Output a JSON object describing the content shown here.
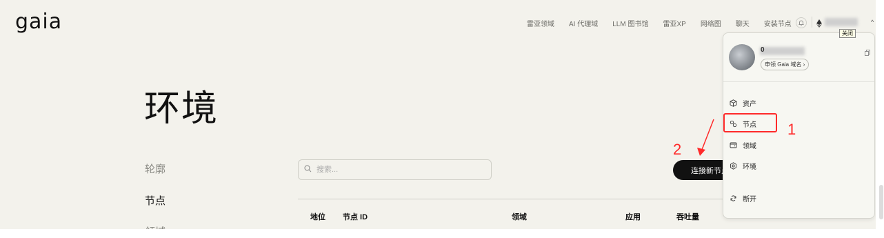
{
  "brand": {
    "logo": "gaia"
  },
  "nav": {
    "items": [
      "雷亚领域",
      "AI 代理域",
      "LLM 图书馆",
      "雷亚XP",
      "网络图",
      "聊天",
      "安装节点"
    ]
  },
  "header": {
    "wallet_tooltip": "关闭"
  },
  "page": {
    "title": "环境",
    "sidebar": [
      "轮廓",
      "节点",
      "领域"
    ],
    "search_placeholder": "搜索...",
    "connect_button": "连接新节点",
    "table_headers": [
      "地位",
      "节点 ID",
      "领域",
      "应用",
      "吞吐量"
    ]
  },
  "dropdown": {
    "user_initial": "0",
    "domain_link": "申领 Gaia 域名 ›",
    "items": [
      {
        "label": "资产",
        "icon": "cube-icon"
      },
      {
        "label": "节点",
        "icon": "node-icon"
      },
      {
        "label": "领域",
        "icon": "wallet-icon"
      },
      {
        "label": "环境",
        "icon": "settings-icon"
      }
    ],
    "disconnect": "断开"
  },
  "annotations": {
    "step1": "1",
    "step2": "2",
    "color": "#ff2a2a"
  }
}
